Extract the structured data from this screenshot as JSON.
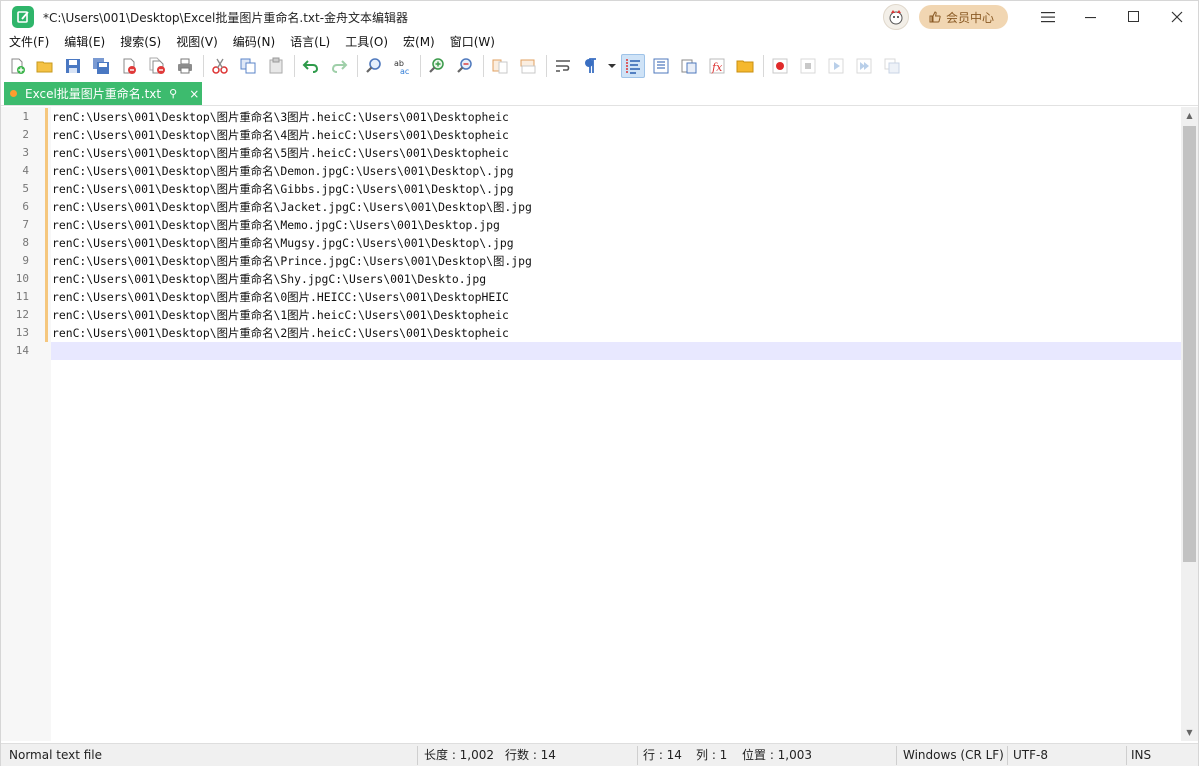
{
  "title": "*C:\\Users\\001\\Desktop\\Excel批量图片重命名.txt-金舟文本编辑器",
  "vip_label": "会员中心",
  "menu": [
    "文件(F)",
    "编辑(E)",
    "搜索(S)",
    "视图(V)",
    "编码(N)",
    "语言(L)",
    "工具(O)",
    "宏(M)",
    "窗口(W)"
  ],
  "tab": {
    "label": "Excel批量图片重命名.txt",
    "pin": "⚲",
    "close": "×"
  },
  "editor": {
    "line_numbers": [
      "1",
      "2",
      "3",
      "4",
      "5",
      "6",
      "7",
      "8",
      "9",
      "10",
      "11",
      "12",
      "13",
      "14"
    ],
    "lines": [
      "renC:\\Users\\001\\Desktop\\图片重命名\\3图片.heicC:\\Users\\001\\Desktopheic",
      "renC:\\Users\\001\\Desktop\\图片重命名\\4图片.heicC:\\Users\\001\\Desktopheic",
      "renC:\\Users\\001\\Desktop\\图片重命名\\5图片.heicC:\\Users\\001\\Desktopheic",
      "renC:\\Users\\001\\Desktop\\图片重命名\\Demon.jpgC:\\Users\\001\\Desktop\\.jpg",
      "renC:\\Users\\001\\Desktop\\图片重命名\\Gibbs.jpgC:\\Users\\001\\Desktop\\.jpg",
      "renC:\\Users\\001\\Desktop\\图片重命名\\Jacket.jpgC:\\Users\\001\\Desktop\\图.jpg",
      "renC:\\Users\\001\\Desktop\\图片重命名\\Memo.jpgC:\\Users\\001\\Desktop.jpg",
      "renC:\\Users\\001\\Desktop\\图片重命名\\Mugsy.jpgC:\\Users\\001\\Desktop\\.jpg",
      "renC:\\Users\\001\\Desktop\\图片重命名\\Prince.jpgC:\\Users\\001\\Desktop\\图.jpg",
      "renC:\\Users\\001\\Desktop\\图片重命名\\Shy.jpgC:\\Users\\001\\Deskto.jpg",
      "renC:\\Users\\001\\Desktop\\图片重命名\\0图片.HEICC:\\Users\\001\\DesktopHEIC",
      "renC:\\Users\\001\\Desktop\\图片重命名\\1图片.heicC:\\Users\\001\\Desktopheic",
      "renC:\\Users\\001\\Desktop\\图片重命名\\2图片.heicC:\\Users\\001\\Desktopheic",
      ""
    ]
  },
  "status": {
    "file_type": "Normal text file",
    "length": "长度 : 1,002",
    "line_count": "行数 : 14",
    "row": "行 : 14",
    "col": "列 : 1",
    "position": "位置 : 1,003",
    "eol": "Windows (CR LF)",
    "encoding": "UTF-8",
    "mode": "INS"
  },
  "colors": {
    "accent": "#3dbb6e",
    "current_line": "#e8e8ff",
    "modified_mark": "#f5c77e"
  }
}
